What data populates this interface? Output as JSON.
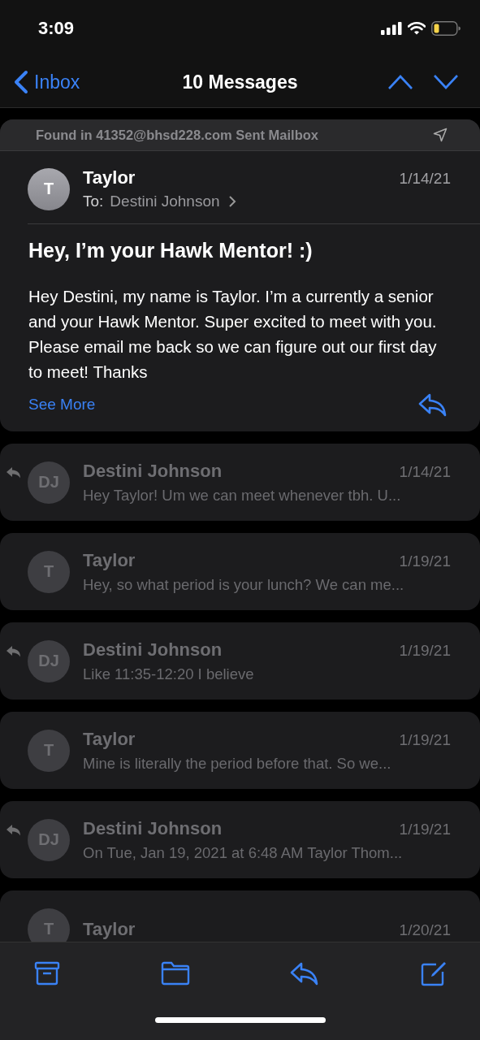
{
  "status_bar": {
    "time": "3:09"
  },
  "nav": {
    "back_label": "Inbox",
    "title": "10 Messages"
  },
  "message": {
    "found_in": "Found in 41352@bhsd228.com Sent Mailbox",
    "initials": "T",
    "sender": "Taylor",
    "date": "1/14/21",
    "to_label": "To:",
    "recipient": "Destini Johnson",
    "subject": "Hey, I’m your Hawk Mentor! :)",
    "body": "Hey Destini, my name is Taylor. I’m a currently a senior and your Hawk Mentor. Super excited to meet with you. Please email me back so we can figure out our first day to meet! Thanks",
    "see_more": "See More"
  },
  "thread": [
    {
      "initials": "DJ",
      "sender": "Destini Johnson",
      "date": "1/14/21",
      "preview": "Hey Taylor! Um we can meet whenever tbh. U...",
      "replied": true
    },
    {
      "initials": "T",
      "sender": "Taylor",
      "date": "1/19/21",
      "preview": "Hey, so what period is your lunch? We can me...",
      "replied": false
    },
    {
      "initials": "DJ",
      "sender": "Destini Johnson",
      "date": "1/19/21",
      "preview": "Like 11:35-12:20 I believe",
      "replied": true
    },
    {
      "initials": "T",
      "sender": "Taylor",
      "date": "1/19/21",
      "preview": "Mine is literally the period before that. So we...",
      "replied": false
    },
    {
      "initials": "DJ",
      "sender": "Destini Johnson",
      "date": "1/19/21",
      "preview": "On Tue, Jan 19, 2021 at 6:48 AM Taylor Thom...",
      "replied": true
    },
    {
      "initials": "T",
      "sender": "Taylor",
      "date": "1/20/21",
      "replied": false
    }
  ]
}
